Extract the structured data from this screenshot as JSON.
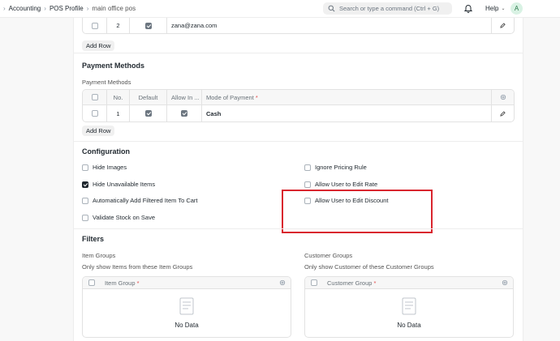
{
  "nav": {
    "breadcrumbs": [
      "Accounting",
      "POS Profile",
      "main office pos"
    ],
    "search_placeholder": "Search or type a command (Ctrl + G)",
    "help_label": "Help",
    "avatar_initial": "A"
  },
  "users_table": {
    "rows": [
      {
        "no": "2",
        "checked": true,
        "user": "zana@zana.com"
      }
    ],
    "add_row_label": "Add Row"
  },
  "payment_methods": {
    "section_title": "Payment Methods",
    "field_label": "Payment Methods",
    "columns": {
      "no": "No.",
      "default": "Default",
      "allow": "Allow In ...",
      "mode": "Mode of Payment"
    },
    "rows": [
      {
        "no": "1",
        "default": true,
        "allow": true,
        "mode": "Cash"
      }
    ],
    "add_row_label": "Add Row"
  },
  "configuration": {
    "section_title": "Configuration",
    "left": [
      {
        "label": "Hide Images",
        "checked": false
      },
      {
        "label": "Hide Unavailable Items",
        "checked": true
      },
      {
        "label": "Automatically Add Filtered Item To Cart",
        "checked": false
      },
      {
        "label": "Validate Stock on Save",
        "checked": false
      }
    ],
    "right": [
      {
        "label": "Ignore Pricing Rule",
        "checked": false
      },
      {
        "label": "Allow User to Edit Rate",
        "checked": false
      },
      {
        "label": "Allow User to Edit Discount",
        "checked": false
      }
    ]
  },
  "filters": {
    "section_title": "Filters",
    "item_groups": {
      "label": "Item Groups",
      "description": "Only show Items from these Item Groups",
      "column": "Item Group",
      "empty": "No Data"
    },
    "customer_groups": {
      "label": "Customer Groups",
      "description": "Only show Customer of these Customer Groups",
      "column": "Customer Group",
      "empty": "No Data"
    }
  },
  "colors": {
    "highlight": "#d9252e",
    "required": "#e24c4c"
  }
}
